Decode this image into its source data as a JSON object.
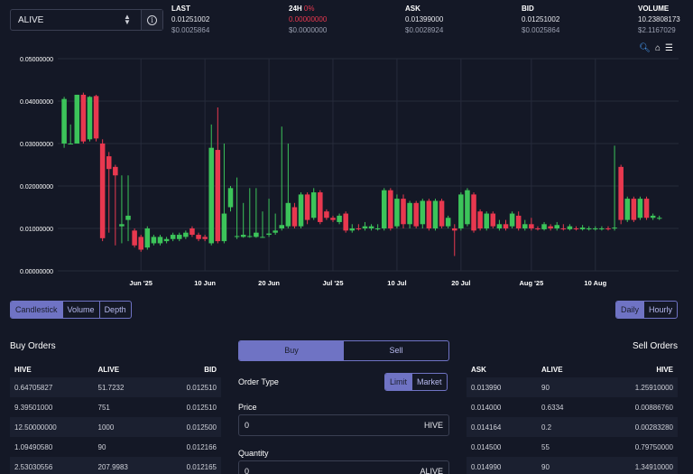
{
  "token": {
    "name": "ALIVE"
  },
  "stats": [
    {
      "label": "LAST",
      "pct": "",
      "v1": "0.01251002",
      "v2": "$0.0025864",
      "red": false
    },
    {
      "label": "24H",
      "pct": "0%",
      "v1": "0.00000000",
      "v2": "$0.0000000",
      "red": true
    },
    {
      "label": "ASK",
      "pct": "",
      "v1": "0.01399000",
      "v2": "$0.0028924",
      "red": false
    },
    {
      "label": "BID",
      "pct": "",
      "v1": "0.01251002",
      "v2": "$0.0025864",
      "red": false
    },
    {
      "label": "VOLUME",
      "pct": "",
      "v1": "10.23808173",
      "v2": "$2.1167029",
      "red": false
    }
  ],
  "icons": {
    "info": "info-icon",
    "zoom": "zoom-icon",
    "home": "home-icon",
    "menu": "menu-icon"
  },
  "colors": {
    "up": "#3cc45a",
    "down": "#e8384f",
    "accent": "#6f73c4"
  },
  "chart_data": {
    "type": "candlestick",
    "ylim": [
      0,
      0.05
    ],
    "y_ticks": [
      "0.00000000",
      "0.01000000",
      "0.02000000",
      "0.03000000",
      "0.04000000",
      "0.05000000"
    ],
    "x_ticks": [
      {
        "label": "Jun '25",
        "day": 31
      },
      {
        "label": "10 Jun",
        "day": 41
      },
      {
        "label": "20 Jun",
        "day": 51
      },
      {
        "label": "Jul '25",
        "day": 61
      },
      {
        "label": "10 Jul",
        "day": 71
      },
      {
        "label": "20 Jul",
        "day": 81
      },
      {
        "label": "Aug '25",
        "day": 92
      },
      {
        "label": "10 Aug",
        "day": 102
      }
    ],
    "x_range_days": [
      18,
      115
    ],
    "candles": [
      [
        19,
        0.03,
        0.0405,
        0.029,
        0.041
      ],
      [
        20,
        0.03,
        0.03,
        0.03,
        0.0345
      ],
      [
        21,
        0.03,
        0.0415,
        0.03,
        0.0415
      ],
      [
        22,
        0.0415,
        0.0305,
        0.03,
        0.042
      ],
      [
        23,
        0.031,
        0.041,
        0.0305,
        0.0412
      ],
      [
        24,
        0.0412,
        0.0312,
        0.0305,
        0.0415
      ],
      [
        25,
        0.03,
        0.0077,
        0.007,
        0.031
      ],
      [
        26,
        0.027,
        0.024,
        0.009,
        0.028
      ],
      [
        27,
        0.0245,
        0.0225,
        0.006,
        0.025
      ],
      [
        28,
        0.0105,
        0.011,
        0.0065,
        0.0225
      ],
      [
        29,
        0.012,
        0.013,
        0.007,
        0.0225
      ],
      [
        30,
        0.0095,
        0.006,
        0.0055,
        0.01
      ],
      [
        31,
        0.008,
        0.005,
        0.0045,
        0.0085
      ],
      [
        32,
        0.0055,
        0.01,
        0.005,
        0.0105
      ],
      [
        33,
        0.0065,
        0.008,
        0.006,
        0.0085
      ],
      [
        34,
        0.0065,
        0.008,
        0.006,
        0.0085
      ],
      [
        35,
        0.007,
        0.0075,
        0.0065,
        0.008
      ],
      [
        36,
        0.0075,
        0.0085,
        0.007,
        0.009
      ],
      [
        37,
        0.0075,
        0.0085,
        0.007,
        0.009
      ],
      [
        38,
        0.008,
        0.009,
        0.0075,
        0.0095
      ],
      [
        39,
        0.01,
        0.0085,
        0.008,
        0.0105
      ],
      [
        40,
        0.0085,
        0.0075,
        0.007,
        0.009
      ],
      [
        41,
        0.008,
        0.0075,
        0.007,
        0.0085
      ],
      [
        42,
        0.0065,
        0.029,
        0.006,
        0.0345
      ],
      [
        43,
        0.0285,
        0.007,
        0.0065,
        0.0385
      ],
      [
        44,
        0.007,
        0.0135,
        0.0065,
        0.03
      ],
      [
        45,
        0.015,
        0.0195,
        0.014,
        0.02
      ],
      [
        46,
        0.008,
        0.0082,
        0.0075,
        0.022
      ],
      [
        47,
        0.008,
        0.0085,
        0.0078,
        0.016
      ],
      [
        48,
        0.008,
        0.0082,
        0.0078,
        0.0195
      ],
      [
        49,
        0.008,
        0.009,
        0.0078,
        0.0195
      ],
      [
        50,
        0.008,
        0.008,
        0.0078,
        0.014
      ],
      [
        51,
        0.0085,
        0.0088,
        0.008,
        0.017
      ],
      [
        52,
        0.009,
        0.0095,
        0.0085,
        0.0135
      ],
      [
        53,
        0.01,
        0.0108,
        0.0095,
        0.034
      ],
      [
        54,
        0.0105,
        0.016,
        0.01,
        0.03
      ],
      [
        55,
        0.015,
        0.0105,
        0.01,
        0.016
      ],
      [
        56,
        0.0105,
        0.018,
        0.01,
        0.0185
      ],
      [
        57,
        0.018,
        0.012,
        0.011,
        0.0185
      ],
      [
        58,
        0.0125,
        0.0185,
        0.012,
        0.0195
      ],
      [
        59,
        0.0185,
        0.0115,
        0.011,
        0.019
      ],
      [
        60,
        0.014,
        0.0125,
        0.012,
        0.0145
      ],
      [
        61,
        0.0125,
        0.012,
        0.0115,
        0.013
      ],
      [
        62,
        0.0115,
        0.013,
        0.011,
        0.0135
      ],
      [
        63,
        0.0135,
        0.0095,
        0.009,
        0.014
      ],
      [
        64,
        0.0095,
        0.01,
        0.009,
        0.011
      ],
      [
        65,
        0.01,
        0.0098,
        0.0095,
        0.011
      ],
      [
        66,
        0.01,
        0.0105,
        0.0095,
        0.0115
      ],
      [
        67,
        0.01,
        0.0105,
        0.0095,
        0.011
      ],
      [
        68,
        0.01,
        0.01,
        0.0095,
        0.011
      ],
      [
        69,
        0.01,
        0.019,
        0.0095,
        0.0195
      ],
      [
        70,
        0.019,
        0.01,
        0.0095,
        0.0195
      ],
      [
        71,
        0.0105,
        0.017,
        0.01,
        0.018
      ],
      [
        72,
        0.017,
        0.011,
        0.01,
        0.018
      ],
      [
        73,
        0.011,
        0.016,
        0.01,
        0.0165
      ],
      [
        74,
        0.016,
        0.0105,
        0.01,
        0.0165
      ],
      [
        75,
        0.011,
        0.0165,
        0.01,
        0.017
      ],
      [
        76,
        0.0165,
        0.01,
        0.0095,
        0.017
      ],
      [
        77,
        0.01,
        0.0165,
        0.0095,
        0.017
      ],
      [
        78,
        0.0165,
        0.0105,
        0.01,
        0.017
      ],
      [
        79,
        0.0105,
        0.0125,
        0.01,
        0.013
      ],
      [
        80,
        0.01,
        0.0095,
        0.0035,
        0.011
      ],
      [
        81,
        0.01,
        0.018,
        0.0095,
        0.0185
      ],
      [
        82,
        0.011,
        0.019,
        0.0105,
        0.0195
      ],
      [
        83,
        0.018,
        0.0095,
        0.009,
        0.0185
      ],
      [
        84,
        0.014,
        0.01,
        0.0095,
        0.0145
      ],
      [
        85,
        0.01,
        0.0135,
        0.0095,
        0.014
      ],
      [
        86,
        0.0135,
        0.0105,
        0.01,
        0.014
      ],
      [
        87,
        0.01,
        0.011,
        0.0095,
        0.012
      ],
      [
        88,
        0.011,
        0.01,
        0.0095,
        0.012
      ],
      [
        89,
        0.0105,
        0.0135,
        0.01,
        0.014
      ],
      [
        90,
        0.013,
        0.01,
        0.0095,
        0.014
      ],
      [
        91,
        0.01,
        0.011,
        0.0095,
        0.012
      ],
      [
        92,
        0.011,
        0.01,
        0.0095,
        0.0125
      ],
      [
        93,
        0.01,
        0.0098,
        0.0095,
        0.0105
      ],
      [
        94,
        0.0098,
        0.011,
        0.0095,
        0.0115
      ],
      [
        95,
        0.0105,
        0.01,
        0.0095,
        0.011
      ],
      [
        96,
        0.01,
        0.0108,
        0.0095,
        0.0115
      ],
      [
        97,
        0.01,
        0.0098,
        0.0095,
        0.011
      ],
      [
        98,
        0.0098,
        0.0105,
        0.0095,
        0.011
      ],
      [
        99,
        0.01,
        0.0098,
        0.0095,
        0.0105
      ],
      [
        100,
        0.0098,
        0.0102,
        0.0095,
        0.0108
      ],
      [
        101,
        0.0098,
        0.01,
        0.0095,
        0.0105
      ],
      [
        102,
        0.0098,
        0.01,
        0.0095,
        0.0105
      ],
      [
        103,
        0.0098,
        0.01,
        0.0095,
        0.0105
      ],
      [
        104,
        0.01,
        0.0098,
        0.0095,
        0.0105
      ],
      [
        105,
        0.01,
        0.0102,
        0.0095,
        0.0295
      ],
      [
        106,
        0.0245,
        0.012,
        0.011,
        0.025
      ],
      [
        107,
        0.012,
        0.017,
        0.0115,
        0.0175
      ],
      [
        108,
        0.017,
        0.012,
        0.0115,
        0.0175
      ],
      [
        109,
        0.0125,
        0.017,
        0.012,
        0.0175
      ],
      [
        110,
        0.017,
        0.0125,
        0.012,
        0.0175
      ],
      [
        111,
        0.0125,
        0.013,
        0.012,
        0.0135
      ],
      [
        112,
        0.0125,
        0.0125,
        0.012,
        0.013
      ]
    ]
  },
  "chart_type_buttons": [
    "Candlestick",
    "Volume",
    "Depth"
  ],
  "interval_buttons": [
    "Daily",
    "Hourly"
  ],
  "buy_orders": {
    "title": "Buy Orders",
    "headers": [
      "HIVE",
      "ALIVE",
      "BID"
    ],
    "rows": [
      [
        "0.64705827",
        "51.7232",
        "0.012510"
      ],
      [
        "9.39501000",
        "751",
        "0.012510"
      ],
      [
        "12.50000000",
        "1000",
        "0.012500"
      ],
      [
        "1.09490580",
        "90",
        "0.012166"
      ],
      [
        "2.53030556",
        "207.9983",
        "0.012165"
      ]
    ]
  },
  "sell_orders": {
    "title": "Sell Orders",
    "headers": [
      "ASK",
      "ALIVE",
      "HIVE"
    ],
    "rows": [
      [
        "0.013990",
        "90",
        "1.25910000"
      ],
      [
        "0.014000",
        "0.6334",
        "0.00886760"
      ],
      [
        "0.014164",
        "0.2",
        "0.00283280"
      ],
      [
        "0.014500",
        "55",
        "0.79750000"
      ],
      [
        "0.014990",
        "90",
        "1.34910000"
      ]
    ]
  },
  "trade_form": {
    "buy_label": "Buy",
    "sell_label": "Sell",
    "order_type_label": "Order Type",
    "limit_label": "Limit",
    "market_label": "Market",
    "price_label": "Price",
    "price_value": "0",
    "price_unit": "HIVE",
    "quantity_label": "Quantity",
    "quantity_value": "0",
    "quantity_unit": "ALIVE"
  }
}
